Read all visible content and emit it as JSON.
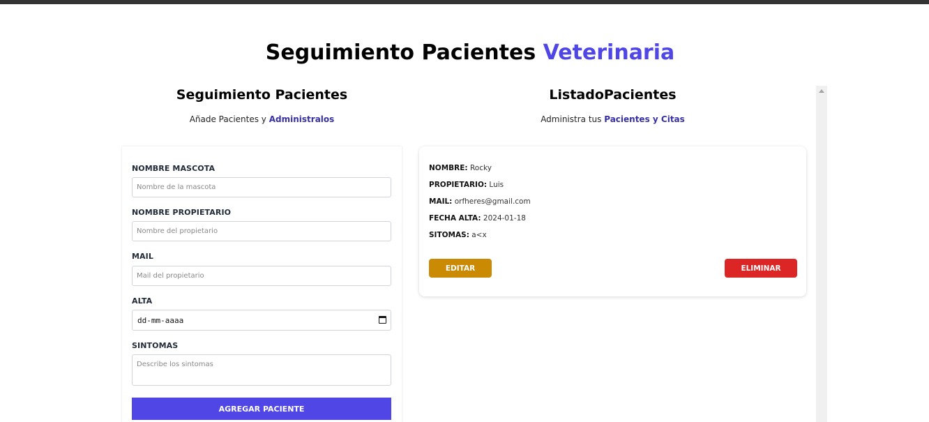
{
  "header": {
    "title_main": "Seguimiento Pacientes",
    "title_accent": "Veterinaria"
  },
  "form_section": {
    "title": "Seguimiento Pacientes",
    "subtitle_prefix": "Añade Pacientes y",
    "subtitle_accent": "Administralos",
    "fields": {
      "pet_name": {
        "label": "NOMBRE MASCOTA",
        "placeholder": "Nombre de la mascota",
        "value": ""
      },
      "owner_name": {
        "label": "NOMBRE PROPIETARIO",
        "placeholder": "Nombre del propietario",
        "value": ""
      },
      "mail": {
        "label": "MAIL",
        "placeholder": "Mail del propietario",
        "value": ""
      },
      "discharge": {
        "label": "ALTA",
        "value": "dd-mm-aaaa",
        "icon": "calendar-icon"
      },
      "symptoms": {
        "label": "SINTOMAS",
        "placeholder": "Describe los sintomas",
        "value": ""
      }
    },
    "submit_label": "AGREGAR PACIENTE"
  },
  "list_section": {
    "title": "ListadoPacientes",
    "subtitle_prefix": "Administra tus",
    "subtitle_accent": "Pacientes y Citas",
    "patients": [
      {
        "name_label": "NOMBRE:",
        "name": "Rocky",
        "owner_label": "PROPIETARIO:",
        "owner": "Luis",
        "mail_label": "MAIL:",
        "mail": "orfheres@gmail.com",
        "date_label": "FECHA ALTA:",
        "date": "2024-01-18",
        "symptoms_label": "SITOMAS:",
        "symptoms": "a<x",
        "edit_label": "EDITAR",
        "delete_label": "ELIMINAR"
      }
    ]
  },
  "colors": {
    "accent": "#4f46e5",
    "edit": "#ca8a04",
    "delete": "#dc2626"
  }
}
